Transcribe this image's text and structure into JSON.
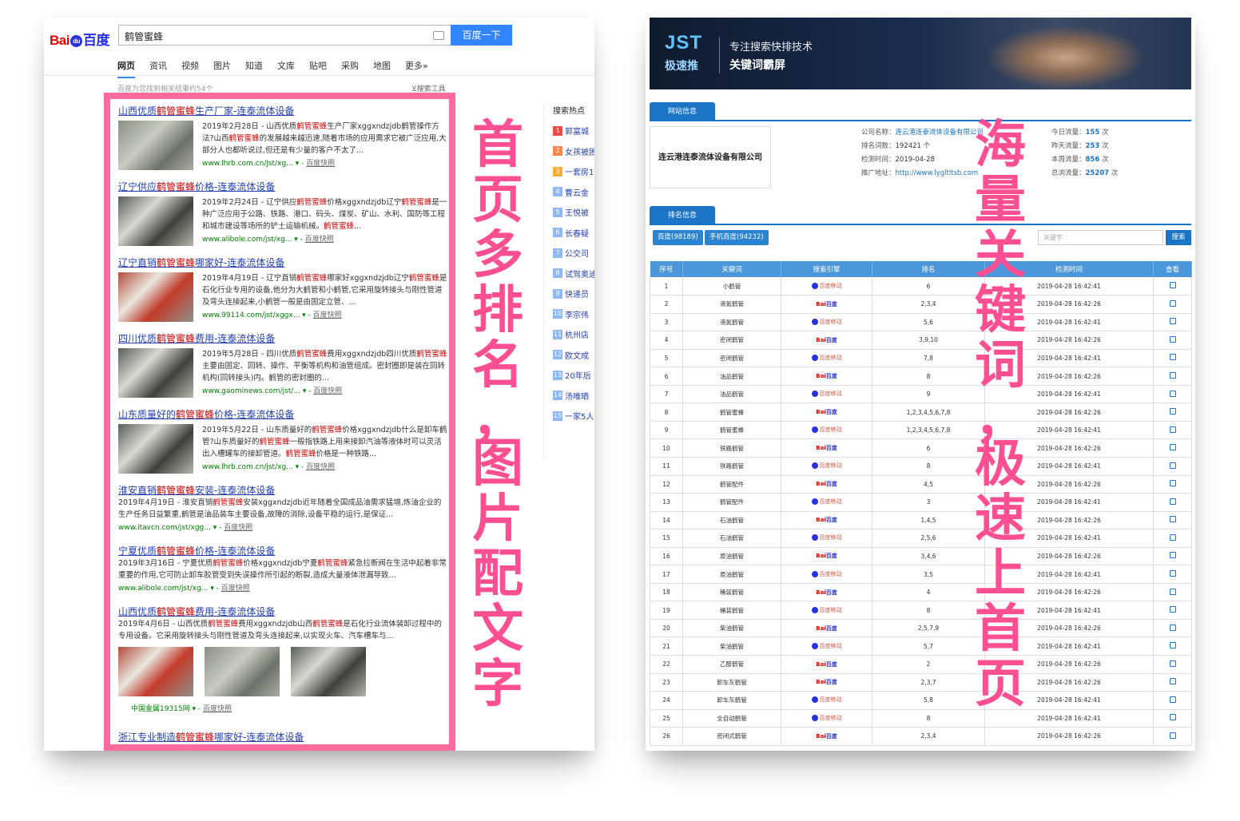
{
  "baidu": {
    "logo": {
      "part1": "Bai",
      "paw": "du",
      "part2": "百度"
    },
    "query": "鹤管蜜蜂",
    "search_button": "百度一下",
    "tabs": [
      "网页",
      "资讯",
      "视频",
      "图片",
      "知道",
      "文库",
      "贴吧",
      "采购",
      "地图",
      "更多»"
    ],
    "result_count": "百度为您找到相关结果约54个",
    "search_tools": "搜索工具",
    "cache_label": "百度快照",
    "results": [
      {
        "title_pre": "山西优质",
        "title_kw": "鹤管蜜蜂",
        "title_post": "生产厂家-连泰流体设备",
        "abstract": "2019年2月28日 - 山西优质鹤管蜜蜂生产厂家xggxndzjdb鹤管操作方法?山西鹤管蜜蜂的发展越来越迅速,随着市场的应用需求它被广泛应用,大部分人也都听说过,但还是有少量的客户不太了...",
        "url": "www.lhrb.com.cn/jst/xg... ▾"
      },
      {
        "title_pre": "辽宁供应",
        "title_kw": "鹤管蜜蜂",
        "title_post": "价格-连泰流体设备",
        "abstract": "2019年2月24日 - 辽宁供应鹤管蜜蜂价格xggxndzjdb辽宁鹤管蜜蜂是一种广泛应用于公路、铁路、港口、码头、煤炭、矿山、水利、国防等工程和城市建设等场所的铲土运输机械。鹤管蜜蜂...",
        "url": "www.alibole.com/jst/xg... ▾"
      },
      {
        "title_pre": "辽宁直销",
        "title_kw": "鹤管蜜蜂",
        "title_post": "哪家好-连泰流体设备",
        "abstract": "2019年4月19日 - 辽宁直销鹤管蜜蜂哪家好xggxndzjdb辽宁鹤管蜜蜂是石化行业专用的设备,他分为大鹤管和小鹤管,它采用旋转接头与刚性管道及弯头连接起来,小鹤管一般是由固定立管、...",
        "url": "www.99114.com/jst/xggx... ▾"
      },
      {
        "title_pre": "四川优质",
        "title_kw": "鹤管蜜蜂",
        "title_post": "费用-连泰流体设备",
        "abstract": "2019年5月28日 - 四川优质鹤管蜜蜂费用xggxndzjdb四川优质鹤管蜜蜂主要由固定、回转、操作、平衡等机构和油管组成。密封圈即是装在回转机构(回转接头)内。鹤管的密封圈的...",
        "url": "www.gaominews.com/jst/... ▾"
      },
      {
        "title_pre": "山东质量好的",
        "title_kw": "鹤管蜜蜂",
        "title_post": "价格-连泰流体设备",
        "abstract": "2019年5月22日 - 山东质量好的鹤管蜜蜂价格xggxndzjdb什么是卸车鹤管?山东质量好的鹤管蜜蜂一般指铁路上用来接卸汽油等液体时可以灵活出入槽罐车的接卸管道。鹤管蜜蜂价格是一种铁路...",
        "url": "www.lhrb.com.cn/jst/xg... ▾"
      },
      {
        "title_pre": "淮安直销",
        "title_kw": "鹤管蜜蜂",
        "title_post": "安装-连泰流体设备",
        "abstract": "2019年4月19日 - 淮安直销鹤管蜜蜂安装xggxndzjdb近年随着全国成品油需求猛增,炼油企业的生产任务日益繁重,鹤管是油品装车主要设备,故障的消除,设备平稳的运行,是保证...",
        "url": "www.itavcn.com/jst/xgg... ▾"
      },
      {
        "title_pre": "宁夏优质",
        "title_kw": "鹤管蜜蜂",
        "title_post": "价格-连泰流体设备",
        "abstract": "2019年3月16日 - 宁夏优质鹤管蜜蜂价格xggxndzjdb宁夏鹤管蜜蜂紧急拉断阀在生活中起着非常重要的作用,它可防止卸车胶管受到失误操作所引起的断裂,造成大量液体泄漏导致...",
        "url": "www.alibole.com/jst/xg... ▾"
      },
      {
        "title_pre": "山西优质",
        "title_kw": "鹤管蜜蜂",
        "title_post": "费用-连泰流体设备",
        "abstract": "2019年4月6日 - 山西优质鹤管蜜蜂费用xggxndzjdb山西鹤管蜜蜂是石化行业流体装卸过程中的专用设备。它采用旋转接头与刚性管道及弯头连接起来,以实现火车、汽车槽车与...",
        "url": "中国金属19315网 ▾"
      },
      {
        "title_pre": "浙江专业制造",
        "title_kw": "鹤管蜜蜂",
        "title_post": "哪家好-连泰流体设备",
        "abstract": "",
        "url": ""
      }
    ],
    "hot_title": "搜索热点",
    "hot_items": [
      "郭富城",
      "女孩被困",
      "一套房1",
      "曹云金",
      "王悦被",
      "长春疑",
      "公交司",
      "试驾奥迪",
      "快递员",
      "李宗伟",
      "杭州店",
      "欧文成",
      "20年后",
      "汤唯晒",
      "一家5人"
    ],
    "overlay_text": "首页多排名，图片配文字"
  },
  "jst": {
    "logo": "JST",
    "logo_sub": "极速推",
    "slogan1": "专注搜索快排技术",
    "slogan2": "关键词霸屏",
    "tab_site": "网站信息",
    "company_box": "连云港连泰流体设备有限公司",
    "info": [
      {
        "label": "公司名称：",
        "value": "连云港连泰流体设备有限公司",
        "link": true
      },
      {
        "label": "排名词数：",
        "value": "192421 个",
        "link": false
      },
      {
        "label": "检测时间：",
        "value": "2019-04-28",
        "link": false
      },
      {
        "label": "推广地址：",
        "value": "http://www.lygltltsb.com",
        "link": true
      }
    ],
    "stats": [
      {
        "label": "今日流量：",
        "value": "155",
        "unit": " 次"
      },
      {
        "label": "昨天流量：",
        "value": "253",
        "unit": " 次"
      },
      {
        "label": "本周流量：",
        "value": "856",
        "unit": " 次"
      },
      {
        "label": "总浏流量：",
        "value": "25207",
        "unit": " 次"
      }
    ],
    "tab_rank": "排名信息",
    "pill1": "百度(98189)",
    "pill2": "手机百度(94232)",
    "keyword_placeholder": "关键字",
    "query_button": "搜索",
    "columns": [
      "序号",
      "关键词",
      "搜索引擎",
      "排名",
      "检测时间",
      "查看"
    ],
    "rows": [
      [
        "1",
        "小鹤管",
        "m",
        "6",
        "2019-04-28 16:42:41"
      ],
      [
        "2",
        "液氮鹤管",
        "b",
        "2,3,4",
        "2019-04-28 16:42:26"
      ],
      [
        "3",
        "液氮鹤管",
        "m",
        "5,6",
        "2019-04-28 16:42:41"
      ],
      [
        "4",
        "密闭鹤管",
        "b",
        "3,9,10",
        "2019-04-28 16:42:26"
      ],
      [
        "5",
        "密闭鹤管",
        "m",
        "7,8",
        "2019-04-28 16:42:41"
      ],
      [
        "6",
        "油品鹤管",
        "b",
        "8",
        "2019-04-28 16:42:26"
      ],
      [
        "7",
        "油品鹤管",
        "m",
        "9",
        "2019-04-28 16:42:41"
      ],
      [
        "8",
        "鹤管蜜蜂",
        "b",
        "1,2,3,4,5,6,7,8",
        "2019-04-28 16:42:26"
      ],
      [
        "9",
        "鹤管蜜蜂",
        "m",
        "1,2,3,4,5,6,7,8",
        "2019-04-28 16:42:41"
      ],
      [
        "10",
        "铁路鹤管",
        "b",
        "6",
        "2019-04-28 16:42:26"
      ],
      [
        "11",
        "铁路鹤管",
        "m",
        "8",
        "2019-04-28 16:42:41"
      ],
      [
        "12",
        "鹤管配件",
        "b",
        "4,5",
        "2019-04-28 16:42:26"
      ],
      [
        "13",
        "鹤管配件",
        "m",
        "3",
        "2019-04-28 16:42:41"
      ],
      [
        "14",
        "石油鹤管",
        "b",
        "1,4,5",
        "2019-04-28 16:42:26"
      ],
      [
        "15",
        "石油鹤管",
        "m",
        "2,5,6",
        "2019-04-28 16:42:41"
      ],
      [
        "16",
        "原油鹤管",
        "b",
        "3,4,6",
        "2019-04-28 16:42:26"
      ],
      [
        "17",
        "原油鹤管",
        "m",
        "3,5",
        "2019-04-28 16:42:41"
      ],
      [
        "18",
        "桶装鹤管",
        "b",
        "4",
        "2019-04-28 16:42:26"
      ],
      [
        "19",
        "桶装鹤管",
        "m",
        "8",
        "2019-04-28 16:42:41"
      ],
      [
        "20",
        "柴油鹤管",
        "b",
        "2,5,7,9",
        "2019-04-28 16:42:26"
      ],
      [
        "21",
        "柴油鹤管",
        "m",
        "5,7",
        "2019-04-28 16:42:41"
      ],
      [
        "22",
        "乙醇鹤管",
        "b",
        "2",
        "2019-04-28 16:42:26"
      ],
      [
        "23",
        "卸车灰鹤管",
        "b",
        "2,3,7",
        "2019-04-28 16:42:26"
      ],
      [
        "24",
        "卸车灰鹤管",
        "m",
        "5,8",
        "2019-04-28 16:42:41"
      ],
      [
        "25",
        "全自动鹤管",
        "m",
        "8",
        "2019-04-28 16:42:41"
      ],
      [
        "26",
        "密闭式鹤管",
        "b",
        "2,3,4",
        "2019-04-28 16:42:26"
      ]
    ],
    "engine_baidu": {
      "a": "Bai",
      "b": "百度"
    },
    "engine_mobile": "百度移动",
    "overlay_text": "海量关键词，极速上首页"
  },
  "colors": {
    "accent_pink": "#ff4f93",
    "frame_pink": "#ff6b9d",
    "baidu_blue": "#3385ff",
    "jst_blue": "#1b74c5",
    "link": "#2440b3",
    "keyword_red": "#cc0000"
  }
}
